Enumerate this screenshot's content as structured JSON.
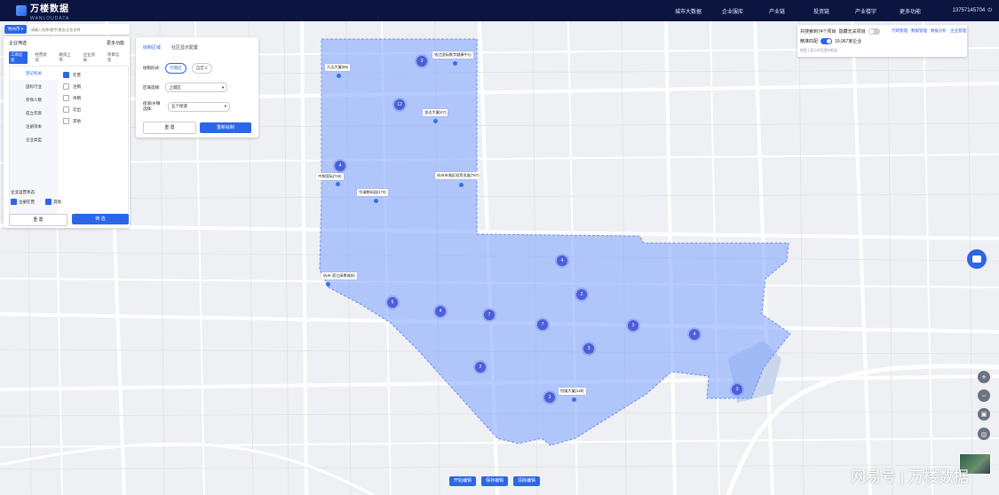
{
  "header": {
    "logo_text": "万楼数据",
    "logo_sub": "WANLOUDATA",
    "nav": [
      "城市大数据",
      "企业服库",
      "产业链",
      "投资链",
      "产业楼宇",
      "更多功能"
    ],
    "phone": "13757145704",
    "bg_color": "#0b1540"
  },
  "search": {
    "city": "杭州市",
    "placeholder": "请输入名称/楼宇/地址/企业名称"
  },
  "filter_panel": {
    "title": "企业筛选",
    "more": "更多功能",
    "tabs": [
      "工商信息",
      "经营状况",
      "融资上市",
      "企业资质",
      "项目信息"
    ],
    "categories": [
      "登记机关",
      "国标行业",
      "参保人数",
      "成立年限",
      "注册资本",
      "企业类型"
    ],
    "options": [
      "在营",
      "注销",
      "吊销",
      "迁出",
      "其他"
    ],
    "status_title": "企业运营状态:",
    "status_options": [
      "注册在营",
      "其他"
    ],
    "reset": "重 置",
    "confirm": "筛 选"
  },
  "config_panel": {
    "tabs": [
      "绘制区域",
      "社区显示配置"
    ],
    "draw_label": "绘制形式:",
    "draw_options": [
      "行政区",
      "自定义"
    ],
    "district_label": "区域选择:",
    "district_value": "上城区",
    "street_label": "街道/乡镇选择:",
    "street_value": "五个街道",
    "reset": "重 置",
    "redraw": "重新绘制"
  },
  "info_panel": {
    "count_text": "共搜索到74个项目",
    "hide_label": "隐藏无关项目",
    "filters": [
      "行政管理",
      "数据管理",
      "数据分析",
      "企业管理"
    ],
    "precise_label": "精准匹配",
    "company_count": "19,967家企业",
    "note": "地图上显示的范围为框选"
  },
  "map_labels": [
    "万达大厦(65)",
    "钱江国际数字健康中心",
    "龙达大厦(47)",
    "中和国际(716)",
    "杭州市城区投资发展(767)",
    "华瑞数码园(173)",
    "杭州·滨江绿景城(6)",
    "恒隆大厦(128)"
  ],
  "clusters": [
    "3",
    "12",
    "4",
    "4",
    "2",
    "6",
    "4",
    "7",
    "7",
    "3",
    "3",
    "4",
    "2",
    "3",
    "3"
  ],
  "bottom_buttons": [
    "开始编辑",
    "保存编辑",
    "清除编辑"
  ],
  "watermark": "网易号 | 万楼数据",
  "colors": {
    "accent": "#2b66e8",
    "region_fill": "#7ea3ff",
    "cluster": "#4a5fd9"
  }
}
